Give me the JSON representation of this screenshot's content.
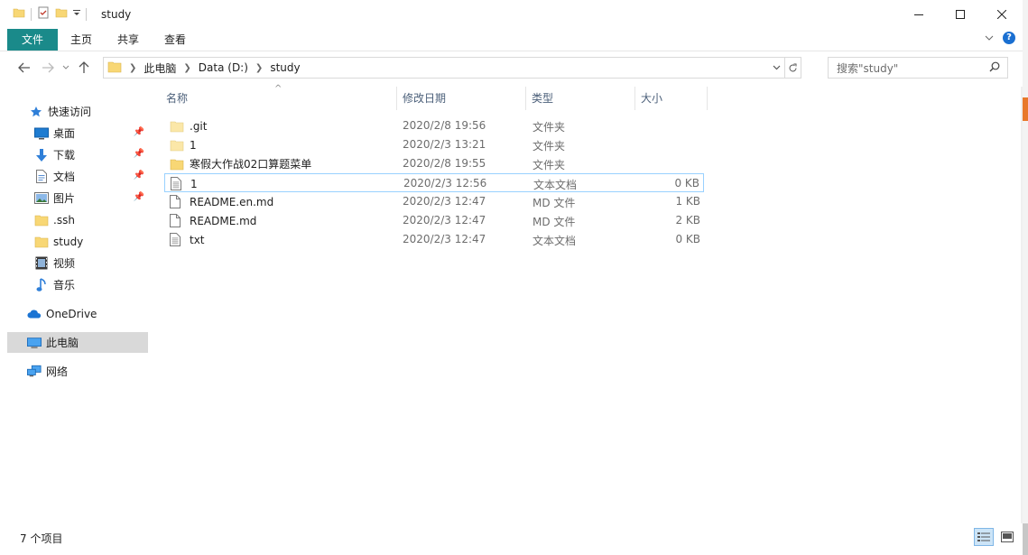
{
  "window": {
    "title": "study",
    "controls": {
      "minimize": "minimize-icon",
      "maximize": "maximize-icon",
      "close": "close-icon"
    }
  },
  "ribbon": {
    "tabs": [
      {
        "label": "文件",
        "active": true
      },
      {
        "label": "主页"
      },
      {
        "label": "共享"
      },
      {
        "label": "查看"
      }
    ],
    "help_label": "?"
  },
  "address": {
    "crumbs": [
      "此电脑",
      "Data (D:)",
      "study"
    ]
  },
  "search": {
    "placeholder": "搜索\"study\""
  },
  "navpane": {
    "items": [
      {
        "label": "快速访问",
        "icon": "star-icon"
      },
      {
        "label": "桌面",
        "icon": "desktop-icon",
        "pinned": true
      },
      {
        "label": "下载",
        "icon": "download-icon",
        "pinned": true
      },
      {
        "label": "文档",
        "icon": "document-icon",
        "pinned": true
      },
      {
        "label": "图片",
        "icon": "pictures-icon",
        "pinned": true
      },
      {
        "label": ".ssh",
        "icon": "folder-icon"
      },
      {
        "label": "study",
        "icon": "folder-icon"
      },
      {
        "label": "视频",
        "icon": "video-icon"
      },
      {
        "label": "音乐",
        "icon": "music-icon"
      },
      {
        "label": "OneDrive",
        "icon": "cloud-icon"
      },
      {
        "label": "此电脑",
        "icon": "computer-icon",
        "selected": true
      },
      {
        "label": "网络",
        "icon": "network-icon"
      }
    ]
  },
  "columns": {
    "name": "名称",
    "date": "修改日期",
    "type": "类型",
    "size": "大小",
    "sort_indicator": "^"
  },
  "files": [
    {
      "name": ".git",
      "date": "2020/2/8 19:56",
      "type": "文件夹",
      "size": "",
      "icon": "folder-light-icon"
    },
    {
      "name": "1",
      "date": "2020/2/3 13:21",
      "type": "文件夹",
      "size": "",
      "icon": "folder-light-icon"
    },
    {
      "name": "寒假大作战02口算题菜单",
      "date": "2020/2/8 19:55",
      "type": "文件夹",
      "size": "",
      "icon": "folder-icon"
    },
    {
      "name": "1",
      "date": "2020/2/3 12:56",
      "type": "文本文档",
      "size": "0 KB",
      "icon": "text-file-icon",
      "focused": true
    },
    {
      "name": "README.en.md",
      "date": "2020/2/3 12:47",
      "type": "MD 文件",
      "size": "1 KB",
      "icon": "file-icon"
    },
    {
      "name": "README.md",
      "date": "2020/2/3 12:47",
      "type": "MD 文件",
      "size": "2 KB",
      "icon": "file-icon"
    },
    {
      "name": "txt",
      "date": "2020/2/3 12:47",
      "type": "文本文档",
      "size": "0 KB",
      "icon": "text-file-icon"
    }
  ],
  "status": {
    "count": "7 个项目"
  },
  "colors": {
    "file_tab": "#1a8a8a",
    "folder": "#f8d775",
    "folder_light": "#fbe7a8",
    "selected_bg": "#d9d9d9",
    "focus_border": "#99d1ff"
  }
}
